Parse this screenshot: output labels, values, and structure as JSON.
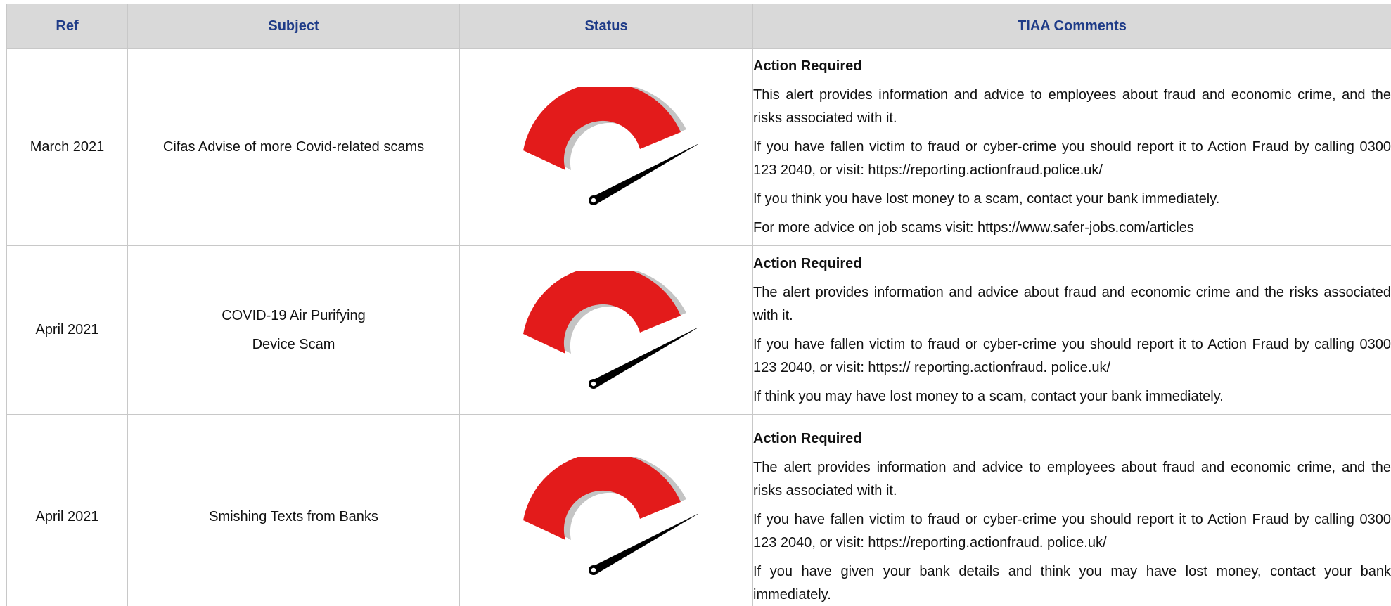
{
  "headers": {
    "ref": "Ref",
    "subject": "Subject",
    "status": "Status",
    "comments": "TIAA Comments"
  },
  "colors": {
    "header_text": "#1f3c88",
    "header_bg": "#d9d9d9",
    "gauge_red": "#e31b1b",
    "gauge_shadow": "#c4c4c4",
    "needle": "#000000"
  },
  "rows": [
    {
      "ref": "March 2021",
      "subject_lines": [
        "Cifas Advise of more Covid-related scams"
      ],
      "status_icon": "risk-gauge-icon",
      "comment_heading": "Action Required",
      "comment_paragraphs": [
        "This alert provides information and advice to employees about fraud and economic crime, and the risks associated with it.",
        "If you have fallen victim to fraud or cyber-crime you should report it to Action Fraud by calling 0300 123 2040, or visit: https://reporting.actionfraud.police.uk/",
        "If you think you have lost money to a scam, contact your bank immediately.",
        "For more advice on job scams visit: https://www.safer-jobs.com/articles"
      ]
    },
    {
      "ref": "April 2021",
      "subject_lines": [
        "COVID-19 Air Purifying",
        "Device Scam"
      ],
      "status_icon": "risk-gauge-icon",
      "comment_heading": "Action Required",
      "comment_paragraphs": [
        "The alert provides information and advice about fraud and economic crime and the risks associated with it.",
        "If you have fallen victim to fraud or cyber-crime you should report it to Action Fraud by calling 0300 123 2040, or visit: https:// reporting.actionfraud. police.uk/",
        "If think you may have lost money to a scam, contact your bank immediately."
      ]
    },
    {
      "ref": "April 2021",
      "subject_lines": [
        "Smishing Texts from Banks"
      ],
      "status_icon": "risk-gauge-icon",
      "comment_heading": "Action Required",
      "comment_paragraphs": [
        "The alert provides information and advice to employees about fraud and economic crime, and the risks associated with it.",
        "If you have fallen victim to fraud or cyber-crime you should report it to Action Fraud by calling 0300 123 2040, or visit: https://reporting.actionfraud. police.uk/",
        "If you have given your bank details and think you may have lost money, contact your bank immediately."
      ]
    }
  ]
}
